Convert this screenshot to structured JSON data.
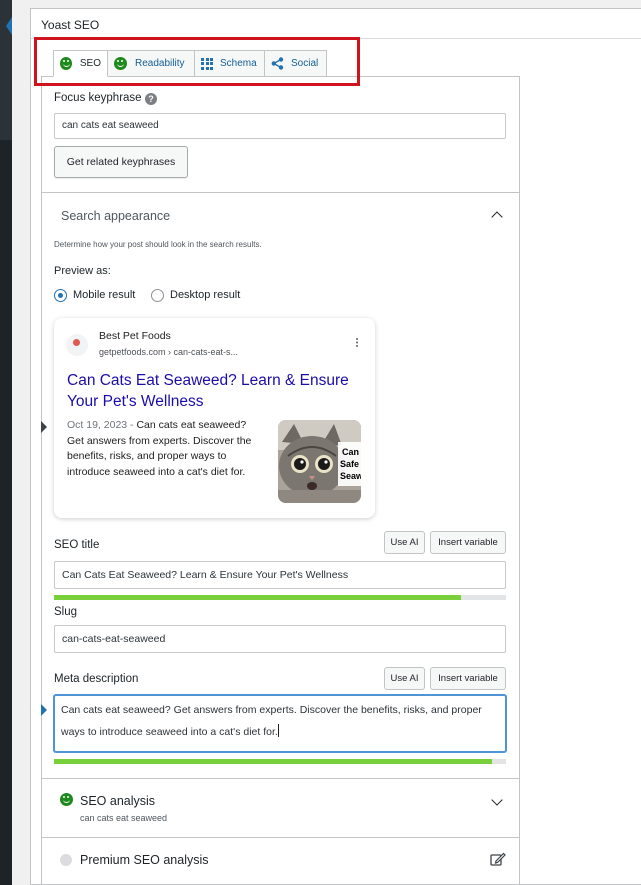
{
  "metabox": {
    "title": "Yoast SEO"
  },
  "tabs": [
    {
      "label": "SEO",
      "icon": "smiley-good-icon",
      "active": true
    },
    {
      "label": "Readability",
      "icon": "smiley-good-icon",
      "active": false
    },
    {
      "label": "Schema",
      "icon": "grid-icon",
      "active": false
    },
    {
      "label": "Social",
      "icon": "share-icon",
      "active": false
    }
  ],
  "focus": {
    "label": "Focus keyphrase",
    "value": "can cats eat seaweed",
    "related_button": "Get related keyphrases"
  },
  "search_appearance": {
    "heading": "Search appearance",
    "hint": "Determine how your post should look in the search results.",
    "preview_as": "Preview as:",
    "mobile": "Mobile result",
    "desktop": "Desktop result",
    "selected": "mobile"
  },
  "serp": {
    "site_name": "Best Pet Foods",
    "site_url": "getpetfoods.com › can-cats-eat-s...",
    "title": "Can Cats Eat Seaweed? Learn & Ensure Your Pet's Wellness",
    "date": "Oct 19, 2023",
    "separator": "-",
    "description": "Can cats eat seaweed? Get answers from experts. Discover the benefits, risks, and proper ways to introduce seaweed into a cat's diet for.",
    "thumb_text": [
      "Can",
      "Safe",
      "Seaw"
    ]
  },
  "seo_title": {
    "label": "SEO title",
    "value": "Can Cats Eat Seaweed? Learn & Ensure Your Pet's Wellness",
    "use_ai": "Use AI",
    "insert_variable": "Insert variable",
    "progress": 0.9
  },
  "slug": {
    "label": "Slug",
    "value": "can-cats-eat-seaweed"
  },
  "meta_description": {
    "label": "Meta description",
    "value": "Can cats eat seaweed? Get answers from experts. Discover the benefits, risks, and proper ways to introduce seaweed into a cat's diet for.",
    "use_ai": "Use AI",
    "insert_variable": "Insert variable",
    "progress": 0.97
  },
  "seo_analysis": {
    "heading": "SEO analysis",
    "subtext": "can cats eat seaweed",
    "status_color": "#1e8a1e"
  },
  "premium_analysis": {
    "heading": "Premium SEO analysis"
  },
  "colors": {
    "accent": "#2271b1",
    "link": "#1a0dab",
    "good": "#7ad03a",
    "highlight": "#d0141f"
  }
}
